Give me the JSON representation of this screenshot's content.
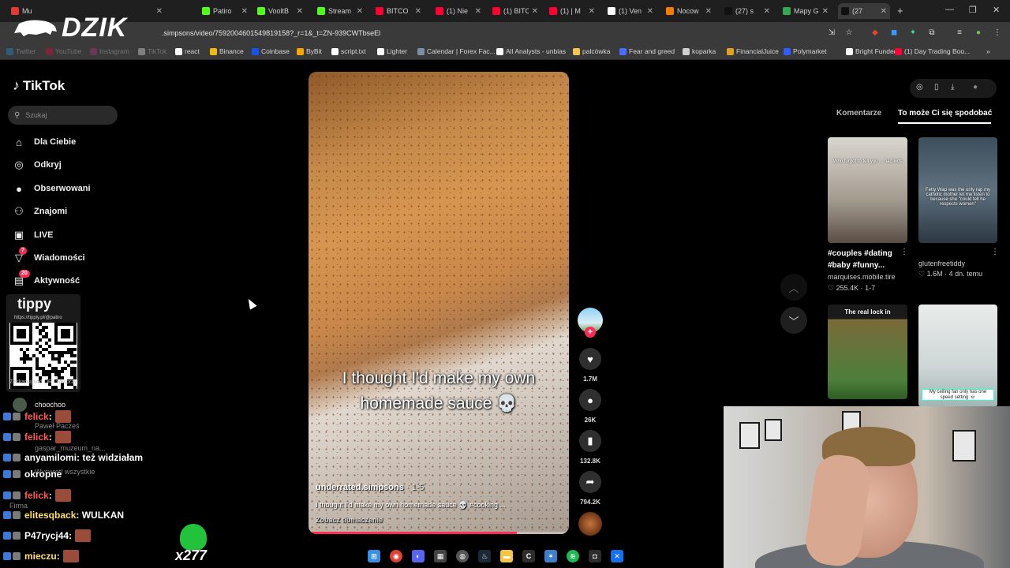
{
  "browser": {
    "tabs": [
      {
        "label": "Mu",
        "color": "#e53935"
      },
      {
        "label": "Patiro",
        "color": "#53fc18"
      },
      {
        "label": "VooltB",
        "color": "#53fc18"
      },
      {
        "label": "Stream",
        "color": "#53fc18"
      },
      {
        "label": "BITCO",
        "color": "#ff0033"
      },
      {
        "label": "(1) Nie",
        "color": "#ff0033"
      },
      {
        "label": "(1) BITC",
        "color": "#ff0033"
      },
      {
        "label": "(1) | M",
        "color": "#ff0033"
      },
      {
        "label": "(1) Ven",
        "color": "#ffffff"
      },
      {
        "label": "Nocow",
        "color": "#f57c00"
      },
      {
        "label": "(27) s",
        "color": "#111111"
      },
      {
        "label": "Mapy G",
        "color": "#34a853"
      },
      {
        "label": "(27",
        "color": "#111111"
      }
    ],
    "new_tab": "+",
    "url": ".simpsons/video/7592004601549819158?_r=1&_t=ZN-939CWTbseEl",
    "bookmarks": [
      {
        "label": "Twitter",
        "color": "#1da1f2"
      },
      {
        "label": "YouTube",
        "color": "#ff0033"
      },
      {
        "label": "Instagram",
        "color": "#c13584"
      },
      {
        "label": "TikTok",
        "color": "#ffffff"
      },
      {
        "label": "react",
        "color": "#ffffff"
      },
      {
        "label": "Binance",
        "color": "#f0b90b"
      },
      {
        "label": "Coinbase",
        "color": "#1652f0"
      },
      {
        "label": "ByBit",
        "color": "#f7a600"
      },
      {
        "label": "script.txt",
        "color": "#ffffff"
      },
      {
        "label": "Lighter",
        "color": "#ffffff"
      },
      {
        "label": "Calendar | Forex Fac...",
        "color": "#7a8fa6"
      },
      {
        "label": "All Analysts - unbias",
        "color": "#ffffff"
      },
      {
        "label": "palcówka",
        "color": "#f5c451"
      },
      {
        "label": "Fear and greed",
        "color": "#4a6cff"
      },
      {
        "label": "koparka",
        "color": "#d0d0d0"
      },
      {
        "label": "FinancialJuice",
        "color": "#e0a020"
      },
      {
        "label": "Polymarket",
        "color": "#2e5cff"
      },
      {
        "label": "Bright Funded",
        "color": "#ffffff"
      },
      {
        "label": "(1) Day Trading Boo...",
        "color": "#ff0033"
      }
    ],
    "bookmarks_more": "»"
  },
  "overlay_logo": {
    "text": "DZIK"
  },
  "tiktok": {
    "logo": "TikTok",
    "search_placeholder": "Szukaj",
    "nav": [
      {
        "label": "Dla Ciebie",
        "icon": "home-icon",
        "glyph": "⌂"
      },
      {
        "label": "Odkryj",
        "icon": "compass-icon",
        "glyph": "◎"
      },
      {
        "label": "Obserwowani",
        "icon": "following-avatar-icon",
        "glyph": "●"
      },
      {
        "label": "Znajomi",
        "icon": "friends-icon",
        "glyph": "⚇"
      },
      {
        "label": "LIVE",
        "icon": "live-icon",
        "glyph": "▣"
      },
      {
        "label": "Wiadomości",
        "icon": "messages-icon",
        "glyph": "▽",
        "badge": "7"
      },
      {
        "label": "Aktywność",
        "icon": "activity-icon",
        "glyph": "▤",
        "badge": "20"
      }
    ],
    "following_user": "choochoo",
    "video": {
      "caption": "I thought I'd make my own homemade sauce 💀",
      "author": "underrated.simpsons",
      "date": "· 1-5",
      "description": "I thought I'd make my own homemade sauce 💀 #cooking ...",
      "translate": "Zobacz tłumaczenie",
      "progress": 0.8
    },
    "actions": {
      "likes": "1.7M",
      "comments": "26K",
      "saves": "132.8K",
      "shares": "794.2K"
    },
    "right_panel": {
      "tab_comments": "Komentarze",
      "tab_recommended": "To może Ci się spodobać",
      "videos": [
        {
          "caption": "#couples #dating #baby #funny...",
          "user": "marquises.mobile.tire",
          "likes": "255.4K",
          "date": "1-7",
          "thumb_text": "Who forgot to tell you ... had kids"
        },
        {
          "caption": "",
          "user": "glutenfreetiddy",
          "likes": "1.6M",
          "date": "4 dn. temu",
          "thumb_text": "Fetty Wap was the only rap my catholic mother let me listen to because she \"could tell he respects women\""
        },
        {
          "thumb_title": "The real lock in"
        },
        {
          "thumb_text": "My ceiling fan only has one speed setting 💀"
        }
      ]
    }
  },
  "stream_overlay": {
    "tippy_title": "tippy",
    "tippy_url": "https://tipply.pl/@patiro",
    "chat": [
      {
        "user": "felick",
        "text": ":",
        "color": "#ff5a5a"
      },
      {
        "user": "felick",
        "text": ":",
        "color": "#ff5a5a"
      },
      {
        "user": "anyamilomi",
        "text": ": też widziałam",
        "color": "#ffffff"
      },
      {
        "user": "okropne",
        "text": "",
        "color": "#ffffff"
      },
      {
        "user": "felick",
        "text": ":",
        "color": "#ff5a5a"
      },
      {
        "user": "elitesqback",
        "text": ": WULKAN",
        "color": "#ffe066"
      },
      {
        "user": "P47rycj44",
        "text": ":",
        "color": "#ffffff"
      },
      {
        "user": "mieczu",
        "text": ":",
        "color": "#ffe066"
      }
    ],
    "faint": {
      "pawel": "Paweł Pacześ",
      "gaspar": "gaspar_muzeum_na...",
      "see_all": "Wyświetl wszystkie",
      "firma": "Firma",
      "qr_sub": "Zeskanuj kod QR i wesprzyj"
    },
    "counter": "x277"
  }
}
